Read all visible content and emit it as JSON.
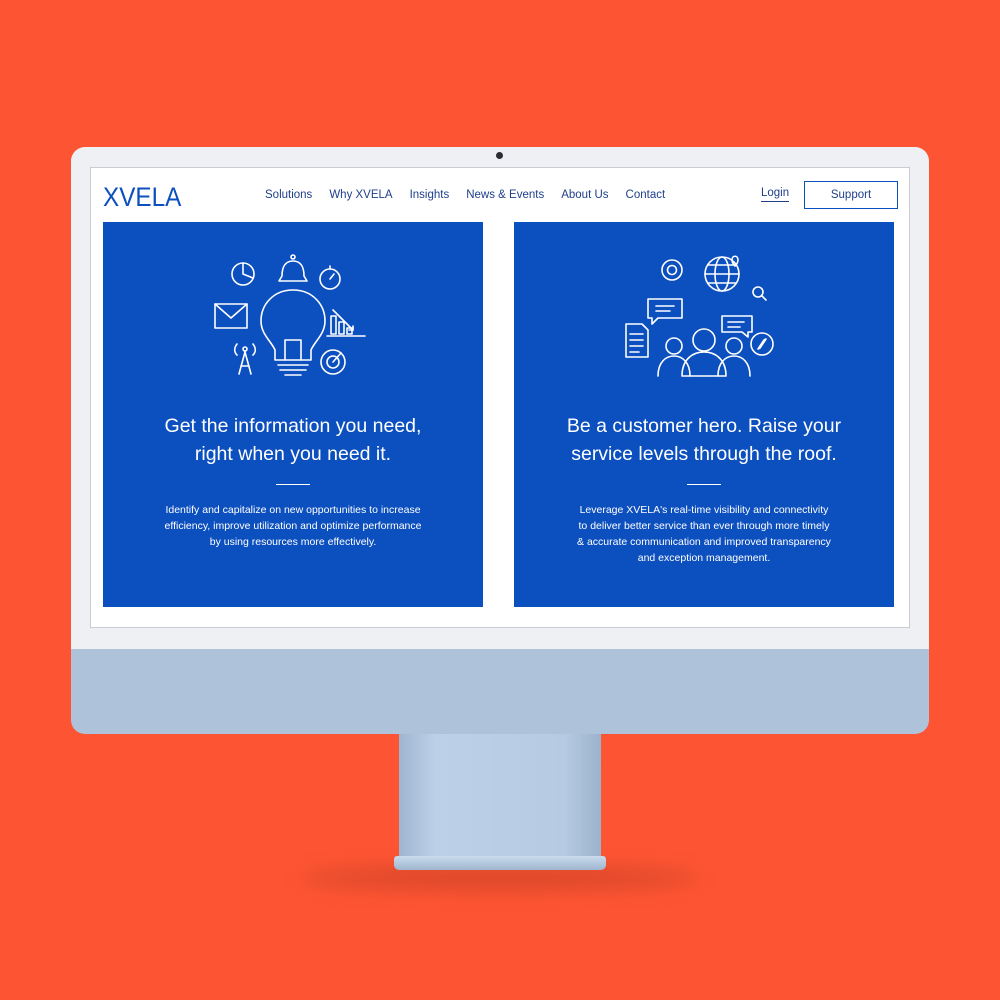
{
  "brand": {
    "logo_text": "XVELA"
  },
  "nav": {
    "links": [
      {
        "label": "Solutions"
      },
      {
        "label": "Why XVELA"
      },
      {
        "label": "Insights"
      },
      {
        "label": "News & Events"
      },
      {
        "label": "About Us"
      },
      {
        "label": "Contact"
      }
    ],
    "login_label": "Login",
    "support_label": "Support"
  },
  "panels": [
    {
      "heading_line1": "Get the information you need,",
      "heading_line2": "right when you need it.",
      "body": "Identify and capitalize on new opportunities to increase efficiency, improve utilization and optimize performance by using resources more effectively.",
      "icon": "lightbulb-insights-illustration"
    },
    {
      "heading_line1": "Be a customer hero. Raise your",
      "heading_line2": "service levels through the roof.",
      "body": "Leverage XVELA's real-time visibility and connectivity to deliver better service than ever through more timely & accurate communication and improved transparency and exception management.",
      "icon": "customer-team-connectivity-illustration"
    }
  ],
  "colors": {
    "background": "#fd5534",
    "brand_blue": "#0c4fbf",
    "nav_text": "#1e3f8a"
  }
}
